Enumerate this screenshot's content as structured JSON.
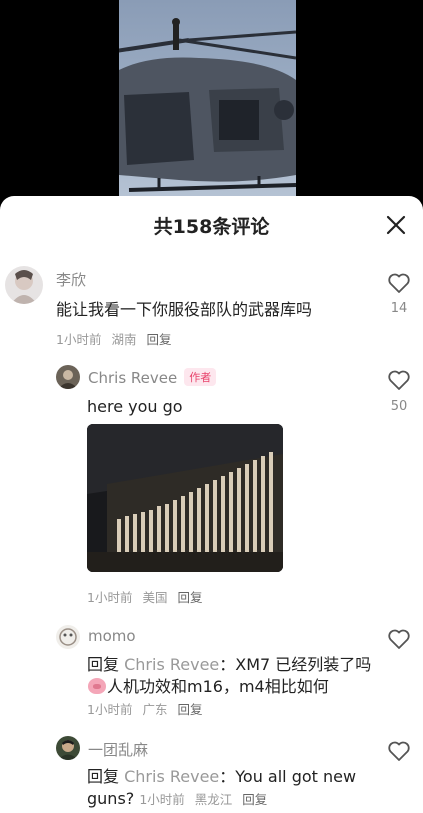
{
  "header": {
    "title": "共158条评论"
  },
  "comments": [
    {
      "user": "李欣",
      "text": "能让我看一下你服役部队的武器库吗",
      "time": "1小时前",
      "location": "湖南",
      "reply_label": "回复",
      "likes": "14"
    },
    {
      "user": "Chris Revee",
      "badge": "作者",
      "text": "here you go",
      "time": "1小时前",
      "location": "美国",
      "reply_label": "回复",
      "likes": "50"
    },
    {
      "user": "momo",
      "reply_prefix": "回复",
      "reply_to": "Chris Revee",
      "text_part1": "：XM7 已经列装了吗",
      "text_part2": "人机功效和m16，m4相比如何",
      "time": "1小时前",
      "location": "广东",
      "reply_label": "回复"
    },
    {
      "user": "一团乱麻",
      "reply_prefix": "回复",
      "reply_to": "Chris Revee",
      "text": "：You all got new guns?",
      "time": "1小时前",
      "location": "黑龙江",
      "reply_label": "回复"
    }
  ],
  "icons": {
    "close": "close-icon",
    "like": "heart-icon",
    "emoji": "pig-emoji-icon"
  },
  "colors": {
    "author_badge": "#e8436b",
    "sheet_bg": "#ffffff"
  }
}
